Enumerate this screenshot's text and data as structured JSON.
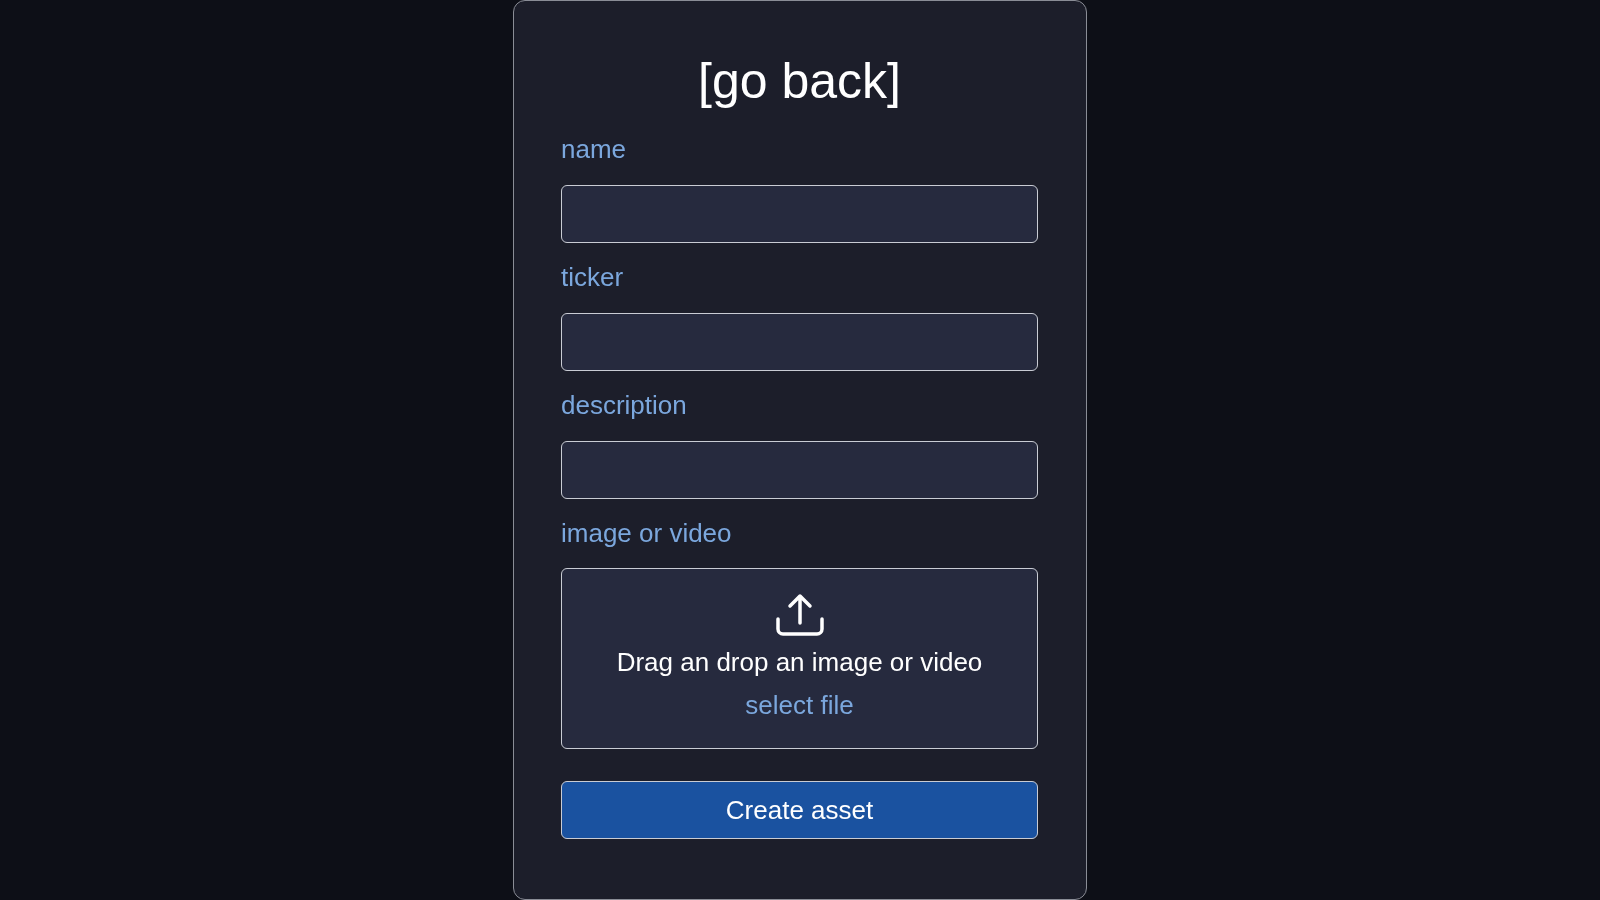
{
  "title": "[go back]",
  "fields": [
    {
      "label": "name"
    },
    {
      "label": "ticker"
    },
    {
      "label": "description"
    }
  ],
  "upload": {
    "label": "image or video",
    "text": "Drag an drop an image or video",
    "link": "select file"
  },
  "button": "Create asset"
}
